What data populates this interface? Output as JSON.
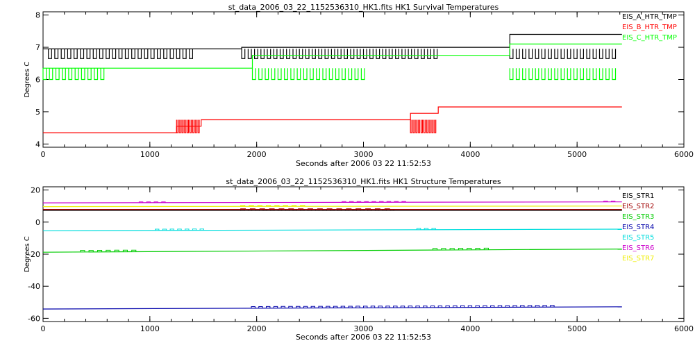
{
  "chart_data": [
    {
      "type": "line",
      "title": "st_data_2006_03_22_1152536310_HK1.fits HK1 Survival Temperatures",
      "xlabel": "Seconds after 2006 03 22 11:52:53",
      "ylabel": "Degrees C",
      "xlim": [
        0,
        6000
      ],
      "ylim": [
        3.9,
        8.1
      ],
      "x_ticks": [
        0,
        1000,
        2000,
        3000,
        4000,
        5000,
        6000
      ],
      "y_ticks": [
        4,
        5,
        6,
        7,
        8
      ],
      "grid": false,
      "legend_position": "top-right",
      "series": [
        {
          "name": "EIS_A_HTR_TMP",
          "color": "#000000",
          "x": [
            0,
            1860,
            1860,
            4370,
            4370,
            5420
          ],
          "y": [
            6.95,
            6.95,
            7.0,
            7.0,
            7.4,
            7.4
          ],
          "toggle": {
            "low": 6.65,
            "high": 6.95,
            "ranges": [
              [
                50,
                1450
              ],
              [
                1860,
                3750
              ],
              [
                4370,
                5400
              ]
            ],
            "period": 60
          }
        },
        {
          "name": "EIS_B_HTR_TMP",
          "color": "#ff0000",
          "x": [
            0,
            1250,
            1250,
            1480,
            1480,
            3440,
            3440,
            3700,
            3700,
            5420
          ],
          "y": [
            4.35,
            4.35,
            4.55,
            4.55,
            4.75,
            4.75,
            4.95,
            4.95,
            5.15,
            5.15
          ],
          "toggle": {
            "low": 4.35,
            "high": 4.75,
            "ranges": [
              [
                1250,
                1480
              ],
              [
                3440,
                3700
              ]
            ],
            "period": 25
          }
        },
        {
          "name": "EIS_C_HTR_TMP",
          "color": "#00ff00",
          "x": [
            0,
            600,
            600,
            1960,
            1960,
            4370,
            4370,
            5420
          ],
          "y": [
            6.35,
            6.35,
            6.35,
            6.35,
            6.75,
            6.75,
            7.1,
            7.1
          ],
          "toggle": {
            "low": 6.0,
            "high": 6.35,
            "ranges": [
              [
                0,
                650
              ],
              [
                1960,
                3050
              ],
              [
                4370,
                5400
              ]
            ],
            "period": 60
          }
        }
      ]
    },
    {
      "type": "line",
      "title": "st_data_2006_03_22_1152536310_HK1.fits HK1 Structure Temperatures",
      "xlabel": "Seconds after 2006 03 22 11:52:53",
      "ylabel": "Degrees C",
      "xlim": [
        0,
        6000
      ],
      "ylim": [
        -62,
        22
      ],
      "x_ticks": [
        0,
        1000,
        2000,
        3000,
        4000,
        5000,
        6000
      ],
      "y_ticks": [
        -60,
        -40,
        -20,
        0,
        20
      ],
      "grid": false,
      "legend_position": "top-right",
      "series": [
        {
          "name": "EIS_STR1",
          "color": "#000000",
          "x": [
            0,
            5420
          ],
          "y": [
            7.3,
            7.3
          ],
          "blips": {
            "dy": 0.6,
            "ranges": [
              [
                1850,
                3300
              ]
            ],
            "period": 35
          }
        },
        {
          "name": "EIS_STR2",
          "color": "#a00000",
          "x": [
            0,
            5420
          ],
          "y": [
            7.9,
            7.9
          ],
          "blips": {
            "dy": 0.4,
            "ranges": [
              [
                1850,
                3300
              ]
            ],
            "period": 45
          }
        },
        {
          "name": "EIS_STR3",
          "color": "#00cc00",
          "x": [
            0,
            5420
          ],
          "y": [
            -18.8,
            -16.8
          ],
          "blips": {
            "dy": 1.0,
            "ranges": [
              [
                350,
                900
              ],
              [
                3650,
                4200
              ]
            ],
            "period": 40
          }
        },
        {
          "name": "EIS_STR4",
          "color": "#0000aa",
          "x": [
            0,
            5420
          ],
          "y": [
            -54.2,
            -52.8
          ],
          "blips": {
            "dy": 1.0,
            "ranges": [
              [
                1950,
                4850
              ]
            ],
            "period": 35
          }
        },
        {
          "name": "EIS_STR5",
          "color": "#00dddd",
          "x": [
            0,
            5420
          ],
          "y": [
            -5.4,
            -4.4
          ],
          "blips": {
            "dy": 0.8,
            "ranges": [
              [
                1050,
                1550
              ],
              [
                3500,
                3700
              ]
            ],
            "period": 35
          }
        },
        {
          "name": "EIS_STR6",
          "color": "#cc00cc",
          "x": [
            0,
            5420
          ],
          "y": [
            12.0,
            12.6
          ],
          "blips": {
            "dy": 0.5,
            "ranges": [
              [
                900,
                1150
              ],
              [
                2800,
                3450
              ],
              [
                5250,
                5400
              ]
            ],
            "period": 35
          }
        },
        {
          "name": "EIS_STR7",
          "color": "#eeee00",
          "x": [
            0,
            5420
          ],
          "y": [
            9.6,
            10.0
          ],
          "blips": {
            "dy": 0.6,
            "ranges": [
              [
                1850,
                2500
              ]
            ],
            "period": 40
          }
        }
      ]
    }
  ]
}
